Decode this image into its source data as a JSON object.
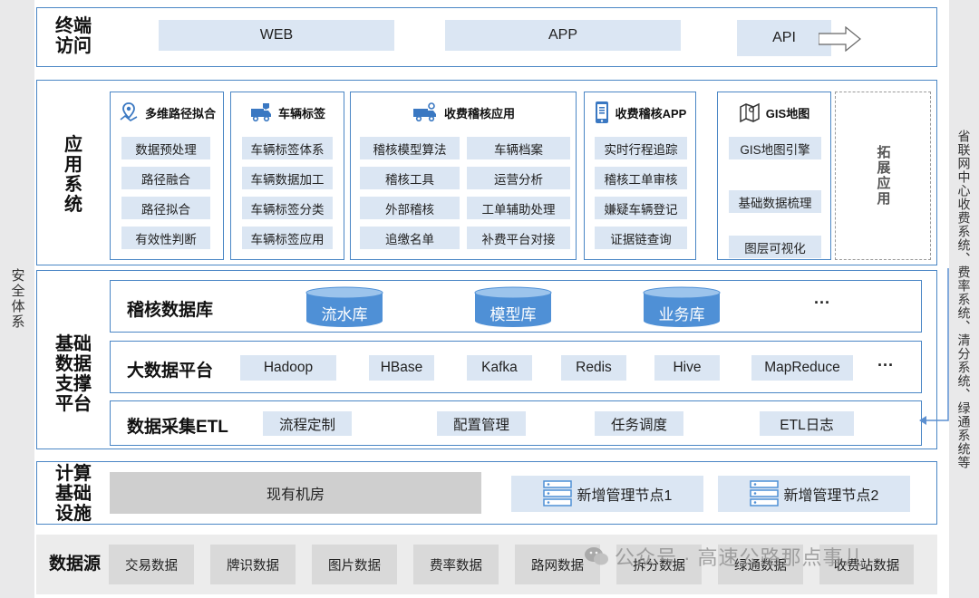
{
  "left_sidebar": {
    "label": "安全体系"
  },
  "right_sidebar": {
    "label": "省联网中心收费系统、费率系统、清分系统、绿通系统等"
  },
  "terminal": {
    "title": "终端访问",
    "items": [
      "WEB",
      "APP",
      "API"
    ]
  },
  "app_system": {
    "title": "应用系统",
    "panels": [
      {
        "icon": "route-map-pin-icon",
        "title": "多维路径拟合",
        "items": [
          "数据预处理",
          "路径融合",
          "路径拟合",
          "有效性判断"
        ]
      },
      {
        "icon": "truck-tag-icon",
        "title": "车辆标签",
        "items": [
          "车辆标签体系",
          "车辆数据加工",
          "车辆标签分类",
          "车辆标签应用"
        ]
      },
      {
        "icon": "truck-audit-icon",
        "title": "收费稽核应用",
        "items": [
          "稽核模型算法",
          "车辆档案",
          "稽核工具",
          "运营分析",
          "外部稽核",
          "工单辅助处理",
          "追缴名单",
          "补费平台对接"
        ]
      },
      {
        "icon": "mobile-app-icon",
        "title": "收费稽核APP",
        "items": [
          "实时行程追踪",
          "稽核工单审核",
          "嫌疑车辆登记",
          "证据链查询"
        ]
      },
      {
        "icon": "gis-map-icon",
        "title": "GIS地图",
        "items": [
          "GIS地图引擎",
          "基础数据梳理",
          "图层可视化"
        ]
      }
    ],
    "expand": "拓展应用"
  },
  "data_platform": {
    "title": "基础数据支撑平台",
    "audit_db": {
      "title": "稽核数据库",
      "dbs": [
        "流水库",
        "模型库",
        "业务库"
      ],
      "more": "···"
    },
    "big_data": {
      "title": "大数据平台",
      "items": [
        "Hadoop",
        "HBase",
        "Kafka",
        "Redis",
        "Hive",
        "MapReduce"
      ],
      "more": "···"
    },
    "etl": {
      "title": "数据采集ETL",
      "items": [
        "流程定制",
        "配置管理",
        "任务调度",
        "ETL日志"
      ]
    }
  },
  "compute": {
    "title": "计算基础设施",
    "existing": "现有机房",
    "nodes": [
      "新增管理节点1",
      "新增管理节点2"
    ]
  },
  "data_source": {
    "title": "数据源",
    "items": [
      "交易数据",
      "牌识数据",
      "图片数据",
      "费率数据",
      "路网数据",
      "拆分数据",
      "绿通数据",
      "收费站数据"
    ]
  },
  "watermark": {
    "text": "公众号 · 高速公路那点事儿"
  },
  "colors": {
    "border": "#4a86c5",
    "cell": "#dbe6f3",
    "cylinder": "#4f90d6",
    "sidebar": "#e9e9ea",
    "gray_box": "#cfcfcf"
  }
}
